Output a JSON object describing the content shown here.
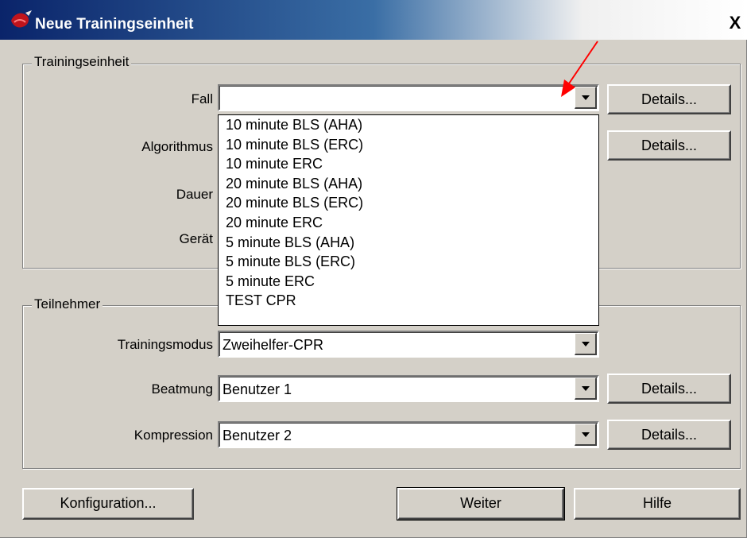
{
  "window": {
    "title": "Neue Trainingseinheit",
    "close_label": "X"
  },
  "training": {
    "group_label": "Trainingseinheit",
    "fall_label": "Fall",
    "fall_value": "",
    "fall_details": "Details...",
    "algorithmus_label": "Algorithmus",
    "algorithmus_details": "Details...",
    "dauer_label": "Dauer",
    "geraet_label": "Gerät"
  },
  "dropdown": {
    "items": [
      "10 minute BLS (AHA)",
      "10 minute BLS (ERC)",
      "10 minute ERC",
      "20 minute BLS (AHA)",
      "20 minute BLS (ERC)",
      "20 minute ERC",
      "5 minute BLS (AHA)",
      "5 minute BLS (ERC)",
      "5 minute ERC",
      "TEST CPR"
    ]
  },
  "participants": {
    "group_label": "Teilnehmer",
    "trainingsmodus_label": "Trainingsmodus",
    "trainingsmodus_value": "Zweihelfer-CPR",
    "beatmung_label": "Beatmung",
    "beatmung_value": "Benutzer 1",
    "beatmung_details": "Details...",
    "kompression_label": "Kompression",
    "kompression_value": "Benutzer 2",
    "kompression_details": "Details..."
  },
  "footer": {
    "konfiguration": "Konfiguration...",
    "weiter": "Weiter",
    "hilfe": "Hilfe"
  },
  "colors": {
    "titlebar_start": "#0a246a",
    "dialog_bg": "#d4d0c8",
    "annotation_arrow": "#ff0000"
  },
  "icons": [
    "app-icon",
    "close-icon",
    "dropdown-arrow-icon",
    "annotation-arrow-icon"
  ]
}
